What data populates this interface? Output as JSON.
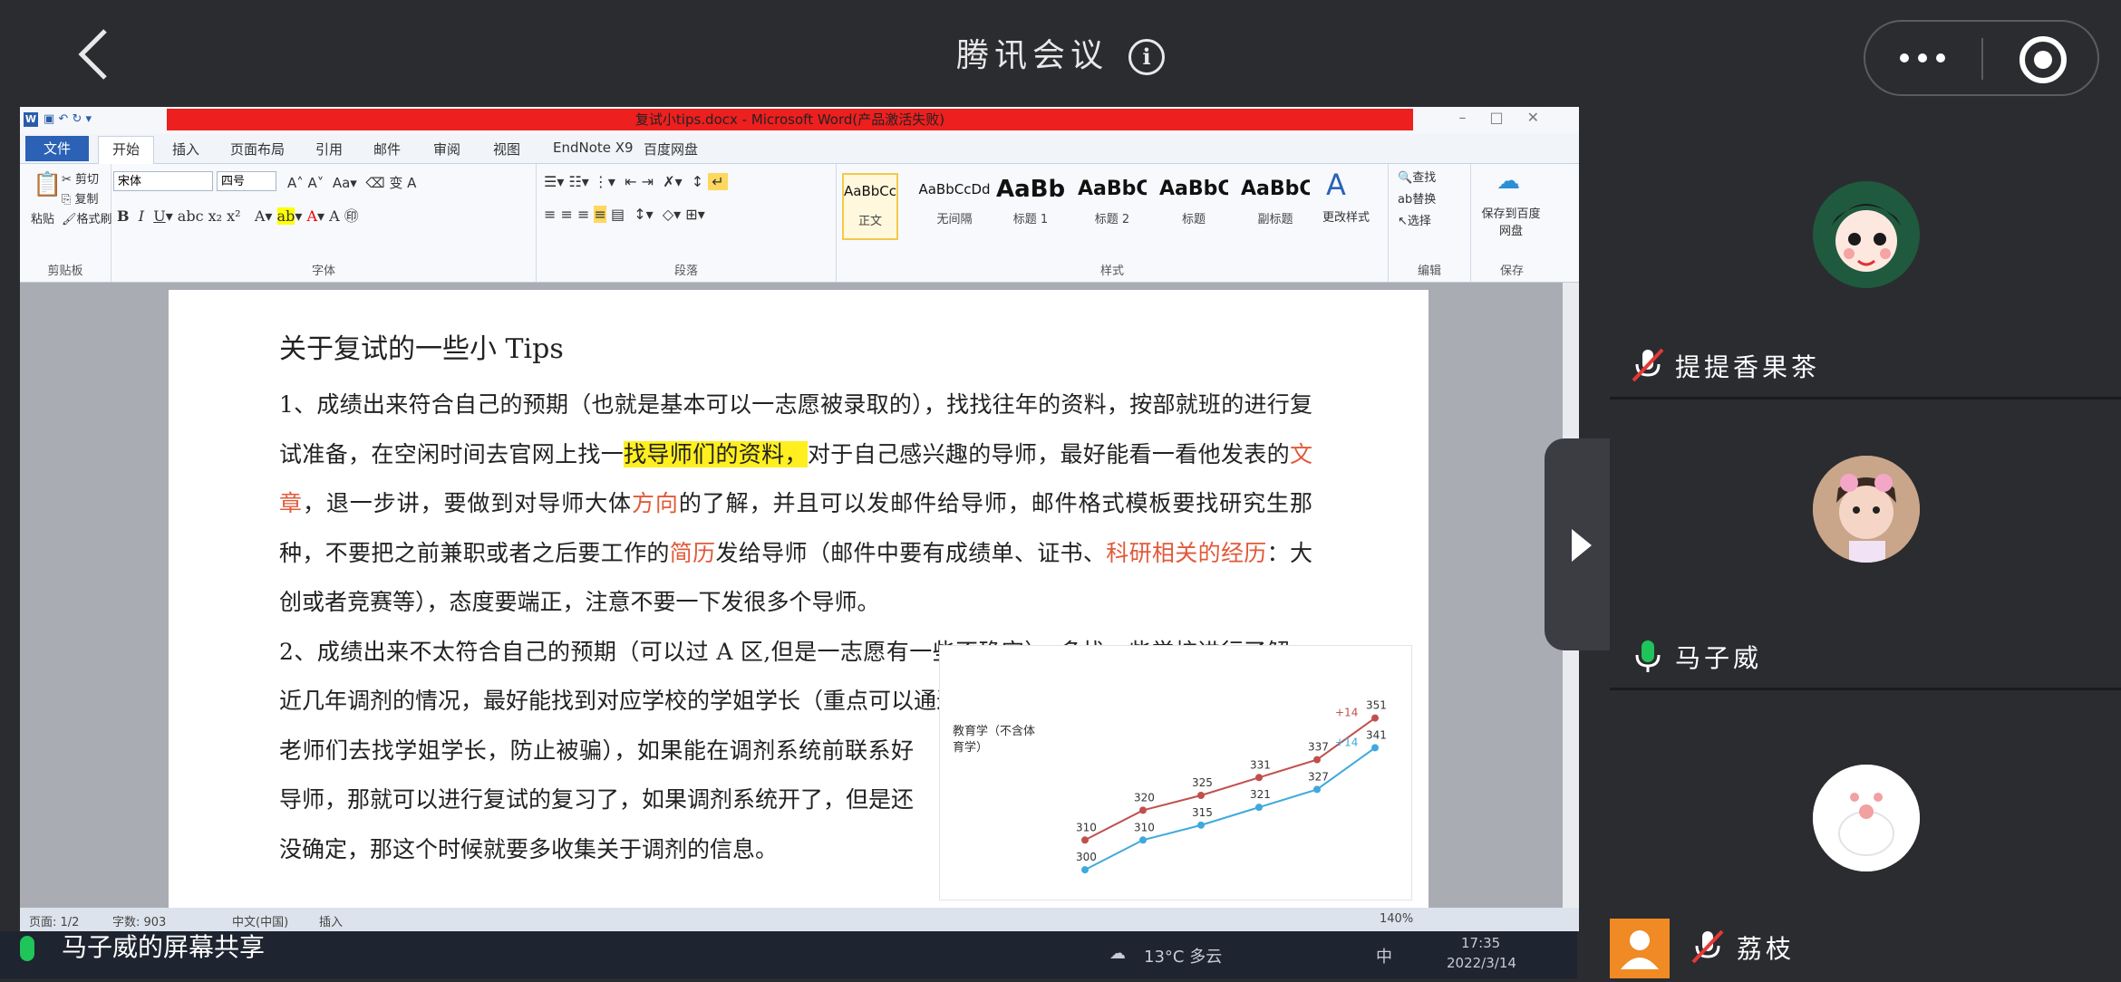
{
  "header": {
    "title": "腾讯会议"
  },
  "word": {
    "window_title": "复试小tips.docx - Microsoft Word(产品激活失败)",
    "tabs": [
      "文件",
      "开始",
      "插入",
      "页面布局",
      "引用",
      "邮件",
      "审阅",
      "视图",
      "EndNote X9",
      "百度网盘"
    ],
    "clipboard": {
      "paste": "粘贴",
      "cut": "剪切",
      "copy": "复制",
      "format_painter": "格式刷",
      "group": "剪贴板"
    },
    "font": {
      "name": "宋体",
      "size": "四号",
      "group": "字体"
    },
    "paragraph_group": "段落",
    "styles": [
      {
        "preview": "AaBbCcDd",
        "name": "正文"
      },
      {
        "preview": "AaBbCcDd",
        "name": "无间隔"
      },
      {
        "preview": "AaBb",
        "name": "标题 1"
      },
      {
        "preview": "AaBbC",
        "name": "标题 2"
      },
      {
        "preview": "AaBbC",
        "name": "标题"
      },
      {
        "preview": "AaBbC",
        "name": "副标题"
      }
    ],
    "change_style": "更改样式",
    "styles_group": "样式",
    "edit": {
      "find": "查找",
      "replace": "替换",
      "select": "选择",
      "group": "编辑"
    },
    "save": {
      "label": "保存到百度网盘",
      "group": "保存"
    },
    "doc": {
      "heading": "关于复试的一些小 Tips",
      "p1_a": "1、成绩出来符合自己的预期（也就是基本可以一志愿被录取的），找找往年的资料，按部就班的进行复试准备，在空闲时间去官网上找一",
      "p1_hl": "找导师们的资料，",
      "p1_b": "对于自己感兴趣的导师，最好能看一看他发表的",
      "p1_r1": "文章",
      "p1_c": "，退一步讲，要做到对导师大体",
      "p1_r2": "方向",
      "p1_d": "的了解，并且可以发邮件给导师，邮件格式模板要找研究生那种，不要把之前兼职或者之后要工作的",
      "p1_r3": "简历",
      "p1_e": "发给导师（邮件中要有成绩单、证书、",
      "p1_r4": "科研相关的经历",
      "p1_f": "：大创或者竞赛等），态度要端正，注意不要一下发很多个导师。",
      "p2_a": "2、成绩出来不太符合自己的预期（可以过 A 区,但是一志愿有一些不确定），多找一些学校进行了解，近几年调剂的情况，最好能找到对应学校的学姐学长（重点可以通过咱们自己学校的",
      "p2_b": "老师们去找学姐学长，防止被骗），如果能在调剂系统前联系好导师，那就可以进行复试的复习了，如果调剂系统开了，但是还没确定，那这个时候就要多收集关于调剂的信息。"
    },
    "status": {
      "page": "页面: 1/2",
      "words": "字数: 903",
      "lang": "中文(中国)",
      "mode": "插入",
      "zoom": "140%"
    }
  },
  "chart_data": {
    "type": "line",
    "title": "",
    "xlabel": "",
    "ylabel": "",
    "legend_label": "教育学（不含体育学）",
    "series": [
      {
        "name": "",
        "color": "#c0504d",
        "values": [
          310,
          320,
          325,
          331,
          337,
          351
        ]
      },
      {
        "name": "",
        "color": "#3fa9dc",
        "values": [
          300,
          310,
          315,
          321,
          327,
          341
        ]
      }
    ],
    "annotations": [
      "+14",
      "+14"
    ],
    "ylim": [
      290,
      360
    ]
  },
  "taskbar": {
    "weather": "13°C 多云",
    "time": "17:35",
    "date": "2022/3/14",
    "ime": "中"
  },
  "share_caption": "马子威的屏幕共享",
  "participants": [
    {
      "name": "提提香果茶",
      "mic": "muted"
    },
    {
      "name": "马子威",
      "mic": "on"
    },
    {
      "name": "荔枝",
      "mic": "muted"
    }
  ],
  "colors": {
    "bg": "#2b2c30",
    "mic_on": "#1fc45a",
    "word_blue": "#2b62b6",
    "title_red": "#ee1f1f"
  }
}
